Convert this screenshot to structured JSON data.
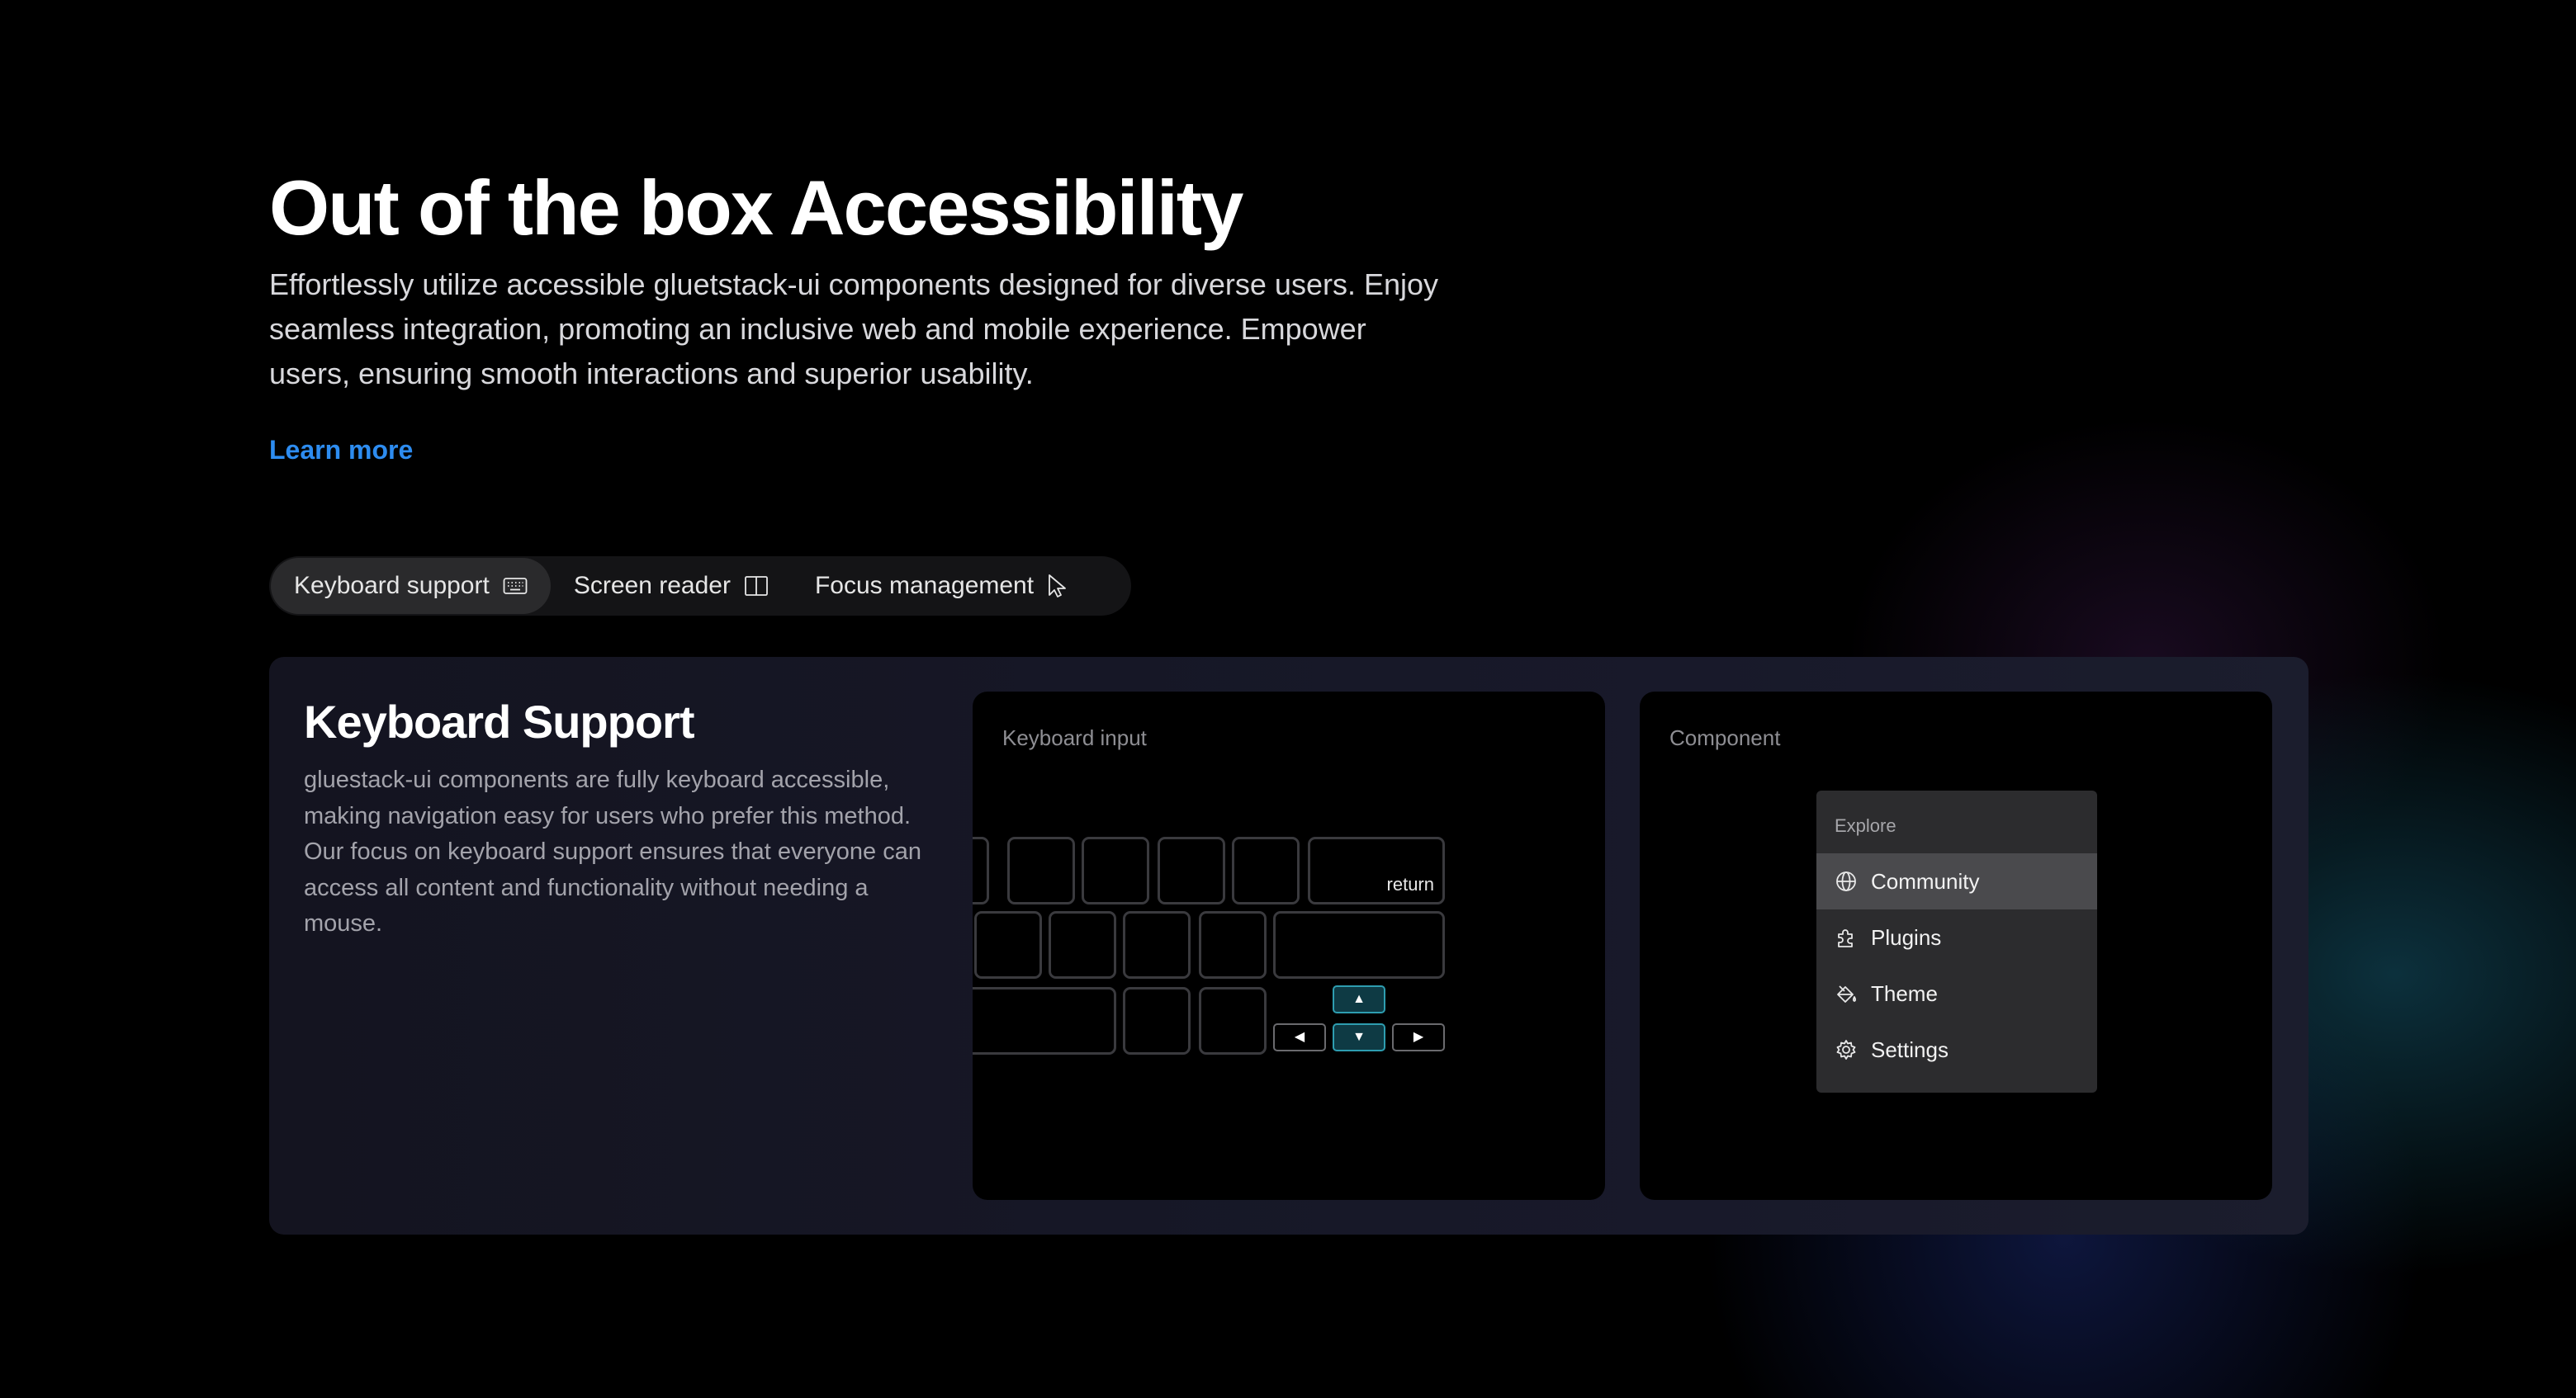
{
  "hero": {
    "title": "Out of the box Accessibility",
    "description": "Effortlessly utilize accessible gluetstack-ui components designed for diverse users. Enjoy seamless integration, promoting an inclusive web and mobile experience. Empower users, ensuring smooth interactions and superior usability.",
    "learn_more": "Learn more",
    "link_color": "#2d8cf0"
  },
  "tabs": [
    {
      "label": "Keyboard support",
      "icon": "keyboard-icon",
      "active": true
    },
    {
      "label": "Screen reader",
      "icon": "book-open-icon",
      "active": false
    },
    {
      "label": "Focus management",
      "icon": "pointer-icon",
      "active": false
    }
  ],
  "panel": {
    "title": "Keyboard Support",
    "description": "gluestack-ui components are fully keyboard accessible, making navigation easy for users who prefer this method. Our focus on keyboard support ensures that everyone can access all content and functionality without needing a mouse.",
    "keyboard_card": {
      "label": "Keyboard input",
      "return_key": "return",
      "arrow_up": "▲",
      "arrow_down": "▼",
      "arrow_left": "◀",
      "arrow_right": "▶",
      "highlight_color": "#2e9db0"
    },
    "component_card": {
      "label": "Component",
      "menu": {
        "heading": "Explore",
        "items": [
          {
            "label": "Community",
            "icon": "globe-icon",
            "active": true
          },
          {
            "label": "Plugins",
            "icon": "puzzle-icon",
            "active": false
          },
          {
            "label": "Theme",
            "icon": "paint-bucket-icon",
            "active": false
          },
          {
            "label": "Settings",
            "icon": "gear-icon",
            "active": false
          }
        ]
      }
    }
  }
}
